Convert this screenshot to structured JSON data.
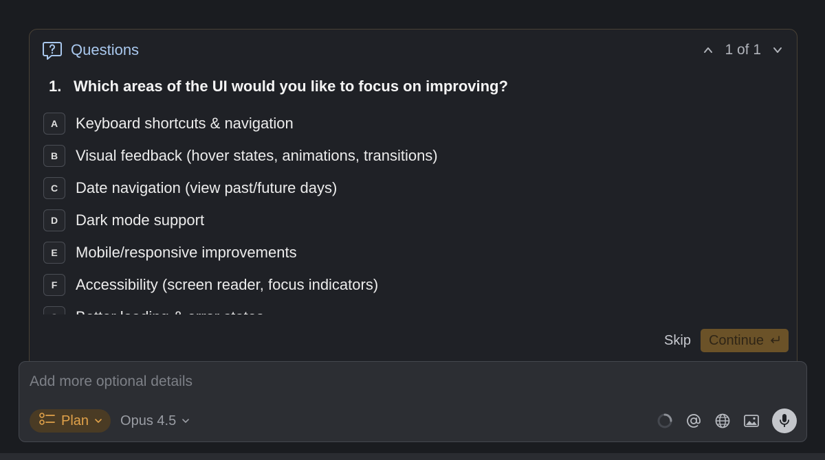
{
  "colors": {
    "background": "#1a1c20",
    "panel_border": "#4a4236",
    "header_accent": "#a9c8ee",
    "continue_bg": "#6b5228",
    "plan_accent": "#e1a24a"
  },
  "header": {
    "icon": "question-bubble-icon",
    "title": "Questions",
    "pager": "1 of 1"
  },
  "question": {
    "number": "1.",
    "text": "Which areas of the UI would you like to focus on improving?"
  },
  "options": [
    {
      "key": "A",
      "label": "Keyboard shortcuts & navigation"
    },
    {
      "key": "B",
      "label": "Visual feedback (hover states, animations, transitions)"
    },
    {
      "key": "C",
      "label": "Date navigation (view past/future days)"
    },
    {
      "key": "D",
      "label": "Dark mode support"
    },
    {
      "key": "E",
      "label": "Mobile/responsive improvements"
    },
    {
      "key": "F",
      "label": "Accessibility (screen reader, focus indicators)"
    },
    {
      "key": "G",
      "label": "Better loading & error states"
    }
  ],
  "actions": {
    "skip": "Skip",
    "continue": "Continue",
    "continue_icon": "return-key-icon"
  },
  "composer": {
    "placeholder": "Add more optional details",
    "mode": "Plan",
    "mode_icon": "plan-list-icon",
    "model": "Opus 4.5",
    "tools": [
      "loading-spinner-icon",
      "at-mention-icon",
      "globe-icon",
      "image-icon",
      "microphone-icon"
    ]
  }
}
